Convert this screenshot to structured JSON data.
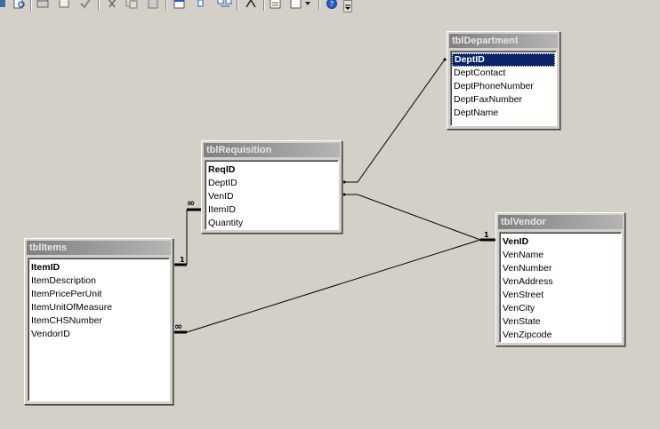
{
  "colors": {
    "canvas": "#d4d0c8",
    "selection": "#0a246a",
    "title_gradient_start": "#808080",
    "title_gradient_end": "#b5b5b5"
  },
  "toolbar": {
    "icons": [
      "print-preview-icon",
      "database-icon",
      "print-icon",
      "spelling-check-icon",
      "cut-icon",
      "copy-icon",
      "paste-icon",
      "show-table-icon",
      "show-direct-icon",
      "show-all-icon",
      "relationship-line-icon",
      "properties-icon",
      "new-object-icon",
      "help-icon",
      "toolbar-options-icon"
    ]
  },
  "tables": {
    "department": {
      "title": "tblDepartment",
      "fields": [
        "DeptID",
        "DeptContact",
        "DeptPhoneNumber",
        "DeptFaxNumber",
        "DeptName"
      ]
    },
    "requisition": {
      "title": "tblRequisition",
      "fields": [
        "ReqID",
        "DeptID",
        "VenID",
        "ItemID",
        "Quantity"
      ]
    },
    "items": {
      "title": "tblItems",
      "fields": [
        "ItemID",
        "ItemDescription",
        "ItemPricePerUnit",
        "ItemUnitOfMeasure",
        "ItemCHSNumber",
        "VendorID"
      ]
    },
    "vendor": {
      "title": "tblVendor",
      "fields": [
        "VenID",
        "VenName",
        "VenNumber",
        "VenAddress",
        "VenStreet",
        "VenCity",
        "VenState",
        "VenZipcode"
      ]
    }
  },
  "relationships": {
    "req_items_many": "∞",
    "req_items_one": "1",
    "items_vendor_many": "∞",
    "items_vendor_one": "1"
  }
}
